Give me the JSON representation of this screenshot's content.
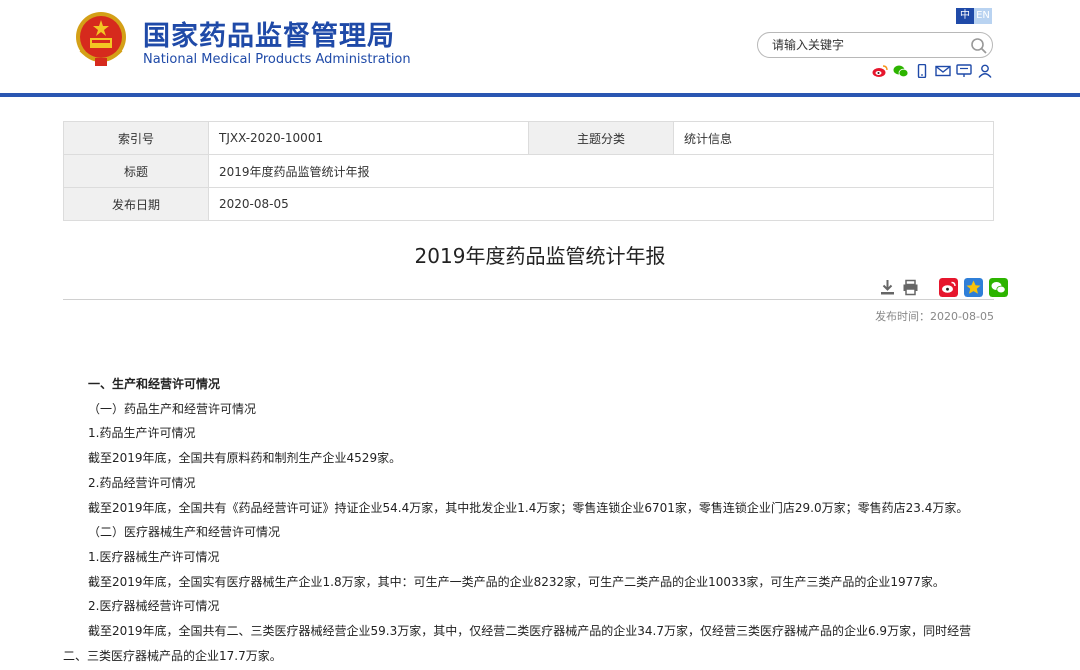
{
  "header": {
    "title_cn": "国家药品监督管理局",
    "title_en": "National Medical Products Administration",
    "lang_cn": "中",
    "lang_en": "EN",
    "search_placeholder": "请输入关键字"
  },
  "icons": [
    "weibo-icon",
    "wechat-icon",
    "mobile-icon",
    "email-icon",
    "message-icon",
    "user-icon"
  ],
  "info": {
    "index_label": "索引号",
    "index_value": "TJXX-2020-10001",
    "category_label": "主题分类",
    "category_value": "统计信息",
    "title_label": "标题",
    "title_value": "2019年度药品监管统计年报",
    "date_label": "发布日期",
    "date_value": "2020-08-05"
  },
  "article": {
    "title": "2019年度药品监管统计年报",
    "pub_time": "发布时间：2020-08-05",
    "paragraphs": [
      "一、生产和经营许可情况",
      "（一）药品生产和经营许可情况",
      "1.药品生产许可情况",
      "截至2019年底，全国共有原料药和制剂生产企业4529家。",
      "2.药品经营许可情况",
      "截至2019年底，全国共有《药品经营许可证》持证企业54.4万家，其中批发企业1.4万家；零售连锁企业6701家，零售连锁企业门店29.0万家；零售药店23.4万家。",
      "（二）医疗器械生产和经营许可情况",
      "1.医疗器械生产许可情况",
      "截至2019年底，全国实有医疗器械生产企业1.8万家，其中：可生产一类产品的企业8232家，可生产二类产品的企业10033家，可生产三类产品的企业1977家。",
      "2.医疗器械经营许可情况",
      "截至2019年底，全国共有二、三类医疗器械经营企业59.3万家，其中，仅经营二类医疗器械产品的企业34.7万家，仅经营三类医疗器械产品的企业6.9万家，同时经营二、三类医疗器械产品的企业17.7万家。"
    ]
  },
  "colors": {
    "brand_blue": "#1f4aa8",
    "bar_blue": "#2a56b2"
  }
}
